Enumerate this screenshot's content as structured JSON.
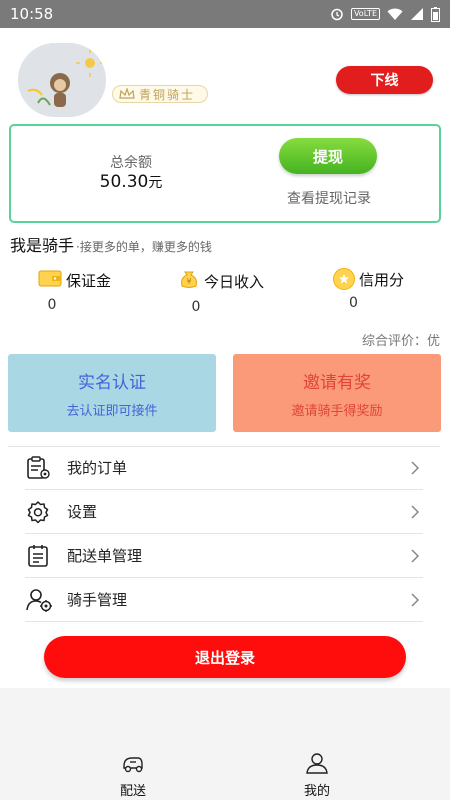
{
  "status_bar": {
    "time": "10:58",
    "icons": [
      "alarm-icon",
      "volte-icon",
      "wifi-icon",
      "signal-icon",
      "battery-icon"
    ],
    "volte_text": "VoLTE"
  },
  "profile": {
    "rank_label": "青铜骑士",
    "offline_button": "下线"
  },
  "balance": {
    "label": "总余额",
    "amount": "50.30",
    "unit": "元",
    "withdraw_button": "提现",
    "withdraw_record_link": "查看提现记录"
  },
  "rider": {
    "title": "我是骑手",
    "subtitle": "·接更多的单，赚更多的钱"
  },
  "stats": [
    {
      "label": "保证金",
      "value": "0",
      "icon": "wallet-icon"
    },
    {
      "label": "今日收入",
      "value": "0",
      "icon": "money-bag-icon"
    },
    {
      "label": "信用分",
      "value": "0",
      "icon": "credit-coin-icon"
    }
  ],
  "rating": "综合评价：优",
  "tiles": {
    "verify": {
      "title": "实名认证",
      "subtitle": "去认证即可接件"
    },
    "invite": {
      "title": "邀请有奖",
      "subtitle": "邀请骑手得奖励"
    }
  },
  "menu": [
    {
      "label": "我的订单",
      "icon": "order-clipboard-icon"
    },
    {
      "label": "设置",
      "icon": "gear-icon"
    },
    {
      "label": "配送单管理",
      "icon": "delivery-list-icon"
    },
    {
      "label": "骑手管理",
      "icon": "rider-settings-icon"
    }
  ],
  "logout_button": "退出登录",
  "tabbar": [
    {
      "label": "配送",
      "icon": "delivery-tab-icon"
    },
    {
      "label": "我的",
      "icon": "profile-tab-icon"
    }
  ],
  "colors": {
    "status_bar": "#7a7a7a",
    "danger_red": "#e11d1d",
    "logout_red": "#ff0c0c",
    "card_border": "#5bd398",
    "withdraw_green": "#45b321",
    "verify_bg": "#a9d7e4",
    "verify_text": "#4563d8",
    "invite_bg": "#fb9a78",
    "invite_text": "#e0443a"
  }
}
